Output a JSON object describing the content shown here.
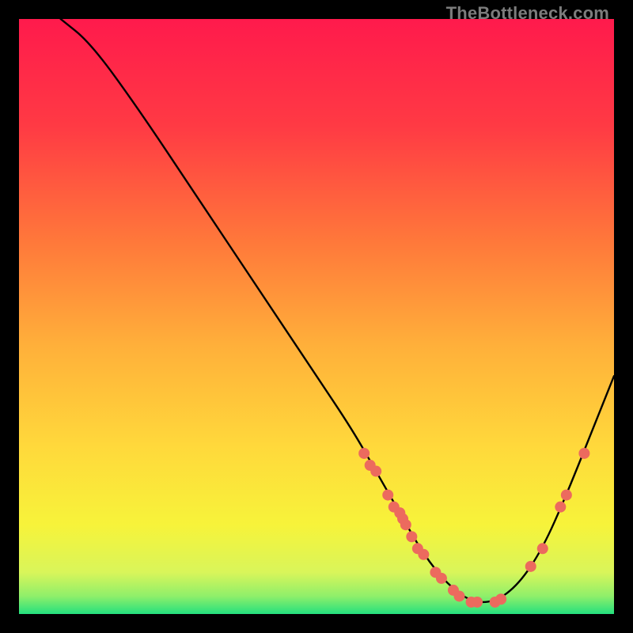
{
  "watermark": "TheBottleneck.com",
  "chart_data": {
    "type": "line",
    "title": "",
    "xlabel": "",
    "ylabel": "",
    "xlim": [
      0,
      100
    ],
    "ylim": [
      0,
      100
    ],
    "grid": false,
    "legend": false,
    "background_gradient": {
      "top_color": "#ff1a4c",
      "mid_color": "#ffd93b",
      "bottom_color": "#24e07e"
    },
    "series": [
      {
        "name": "curve",
        "type": "line",
        "color": "#000000",
        "x": [
          7,
          12,
          20,
          30,
          40,
          50,
          56,
          60,
          64,
          68,
          72,
          76,
          80,
          84,
          88,
          92,
          96,
          100
        ],
        "y": [
          100,
          96,
          85,
          70,
          55,
          40,
          31,
          24,
          17,
          10,
          5,
          2,
          2,
          5,
          11,
          20,
          30,
          40
        ]
      },
      {
        "name": "markers",
        "type": "scatter",
        "color": "#ec6a5e",
        "points": [
          {
            "x": 58,
            "y": 27
          },
          {
            "x": 59,
            "y": 25
          },
          {
            "x": 60,
            "y": 24
          },
          {
            "x": 62,
            "y": 20
          },
          {
            "x": 63,
            "y": 18
          },
          {
            "x": 64,
            "y": 17
          },
          {
            "x": 64.5,
            "y": 16
          },
          {
            "x": 65,
            "y": 15
          },
          {
            "x": 66,
            "y": 13
          },
          {
            "x": 67,
            "y": 11
          },
          {
            "x": 68,
            "y": 10
          },
          {
            "x": 70,
            "y": 7
          },
          {
            "x": 71,
            "y": 6
          },
          {
            "x": 73,
            "y": 4
          },
          {
            "x": 74,
            "y": 3
          },
          {
            "x": 76,
            "y": 2
          },
          {
            "x": 77,
            "y": 2
          },
          {
            "x": 80,
            "y": 2
          },
          {
            "x": 81,
            "y": 2.5
          },
          {
            "x": 86,
            "y": 8
          },
          {
            "x": 88,
            "y": 11
          },
          {
            "x": 91,
            "y": 18
          },
          {
            "x": 92,
            "y": 20
          },
          {
            "x": 95,
            "y": 27
          }
        ]
      }
    ]
  }
}
